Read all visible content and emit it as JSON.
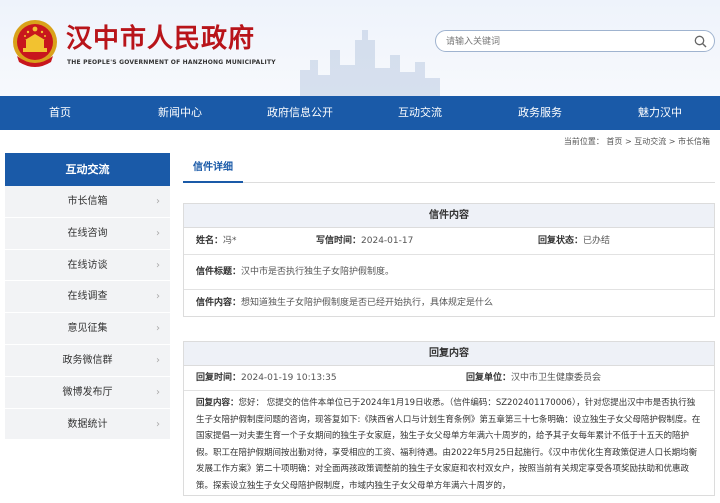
{
  "header": {
    "title": "汉中市人民政府",
    "subtitle": "THE PEOPLE'S GOVERNMENT OF HANZHONG MUNICIPALITY",
    "search_placeholder": "请输入关键词"
  },
  "nav": {
    "items": [
      "首页",
      "新闻中心",
      "政府信息公开",
      "互动交流",
      "政务服务",
      "魅力汉中"
    ]
  },
  "breadcrumb": "当前位置： 首页 > 互动交流 > 市长信箱",
  "sidebar": {
    "title": "互动交流",
    "items": [
      "市长信箱",
      "在线咨询",
      "在线访谈",
      "在线调查",
      "意见征集",
      "政务微信群",
      "微博发布厅",
      "数据统计"
    ]
  },
  "content": {
    "tab": "信件详细",
    "letter": {
      "title": "信件内容",
      "name_label": "姓名：",
      "name_value": "冯*",
      "date_label": "写信时间：",
      "date_value": "2024-01-17",
      "status_label": "回复状态：",
      "status_value": "已办结",
      "subject_label": "信件标题：",
      "subject_value": "汉中市是否执行独生子女陪护假制度。",
      "body_label": "信件内容：",
      "body_value": "想知道独生子女陪护假制度是否已经开始执行，具体规定是什么"
    },
    "reply": {
      "title": "回复内容",
      "time_label": "回复时间：",
      "time_value": "2024-01-19 10:13:35",
      "unit_label": "回复单位：",
      "unit_value": "汉中市卫生健康委员会",
      "body_label": "回复内容：",
      "body_value": "您好：  您提交的信件本单位已于2024年1月19日收悉。（信件编码：SZ202401170006），针对您提出汉中市是否执行独生子女陪护假制度问题的咨询，现答复如下:《陕西省人口与计划生育条例》第五章第三十七条明确：设立独生子女父母陪护假制度。在国家提倡一对夫妻生育一个子女期间的独生子女家庭，独生子女父母单方年满六十周岁的，给予其子女每年累计不低于十五天的陪护假。职工在陪护假期间按出勤对待，享受相应的工资、福利待遇。由2022年5月25日起施行。《汉中市优化生育政策促进人口长期均衡发展工作方案》第二十项明确：对全面两孩政策调整前的独生子女家庭和农村双女户，按照当前有关规定享受各项奖励扶助和优惠政策。探索设立独生子女父母陪护假制度，市域内独生子女父母单方年满六十周岁的，"
    }
  }
}
